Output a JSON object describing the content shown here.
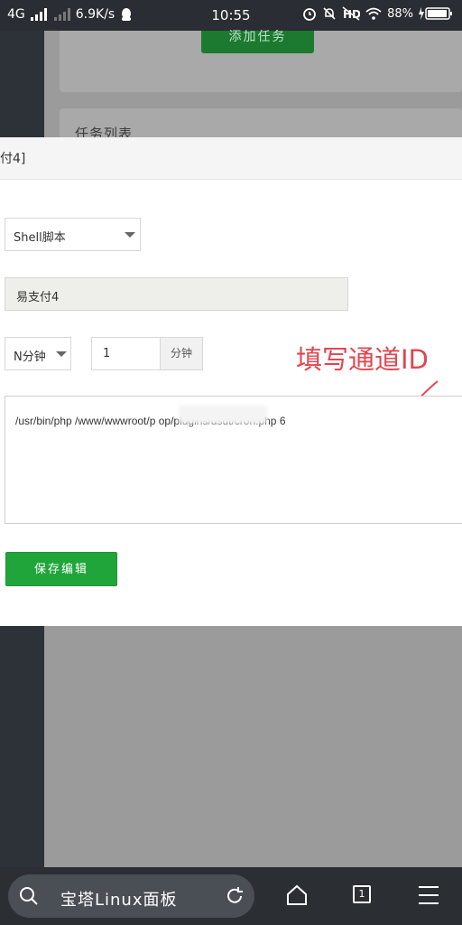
{
  "status_bar": {
    "network": "4G",
    "speed": "6.9K/s",
    "time": "10:55",
    "battery": "88%"
  },
  "background": {
    "add_task_label": "添加任务",
    "task_list_label": "任务列表"
  },
  "modal": {
    "title_fragment": "付4]",
    "task_type": "Shell脚本",
    "task_name": "易支付4",
    "period": "N分钟",
    "interval_value": "1",
    "interval_unit": "分钟",
    "script": "/usr/bin/php /www/wwwroot/p          op/plugins/usdt/cron.php 6",
    "save_label": "保存编辑"
  },
  "annotation": {
    "text": "填写通道ID",
    "color": "#e2454f"
  },
  "browser": {
    "title": "宝塔Linux面板",
    "tab_count": "1"
  },
  "colors": {
    "primary_green": "#20a53a",
    "status_bar": "#2a2d33"
  }
}
